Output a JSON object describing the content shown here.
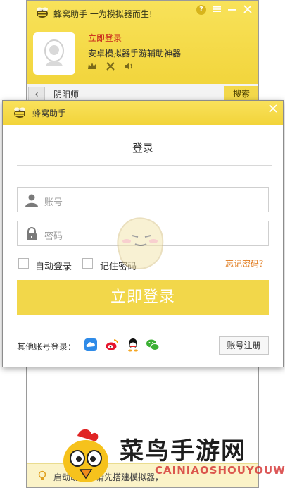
{
  "back_window": {
    "title": "蜂窝助手 一为模拟器而生!",
    "help_icon": "?",
    "login_link": "立即登录",
    "slogan": "安卓模拟器手游辅助神器",
    "search_query": "阴阳师",
    "search_button": "搜索",
    "status_text": "启动助手，请先搭建模拟器，"
  },
  "dialog": {
    "title": "蜂窝助手",
    "heading": "登录",
    "account_placeholder": "账号",
    "password_placeholder": "密码",
    "auto_login_label": "自动登录",
    "remember_password_label": "记住密码",
    "forgot_password": "忘记密码？",
    "login_button": "立即登录",
    "other_accounts_label": "其他账号登录：",
    "register_button": "账号注册"
  },
  "watermark": {
    "cn": "菜鸟手游网",
    "en": "CAINIAOSHOUYOUWANG"
  },
  "colors": {
    "brand_yellow": "#f2d74a",
    "header_yellow": "#f8e25a",
    "link_red": "#c8211b",
    "forgot_orange": "#e07a1c"
  },
  "icons": [
    "bee-logo-icon",
    "help-icon",
    "menu-icon",
    "minimize-icon",
    "close-icon",
    "avatar-icon",
    "crown-icon",
    "swords-icon",
    "speaker-icon",
    "user-icon",
    "lock-icon",
    "cloud-icon",
    "weibo-icon",
    "qq-icon",
    "wechat-icon",
    "bulb-icon"
  ]
}
